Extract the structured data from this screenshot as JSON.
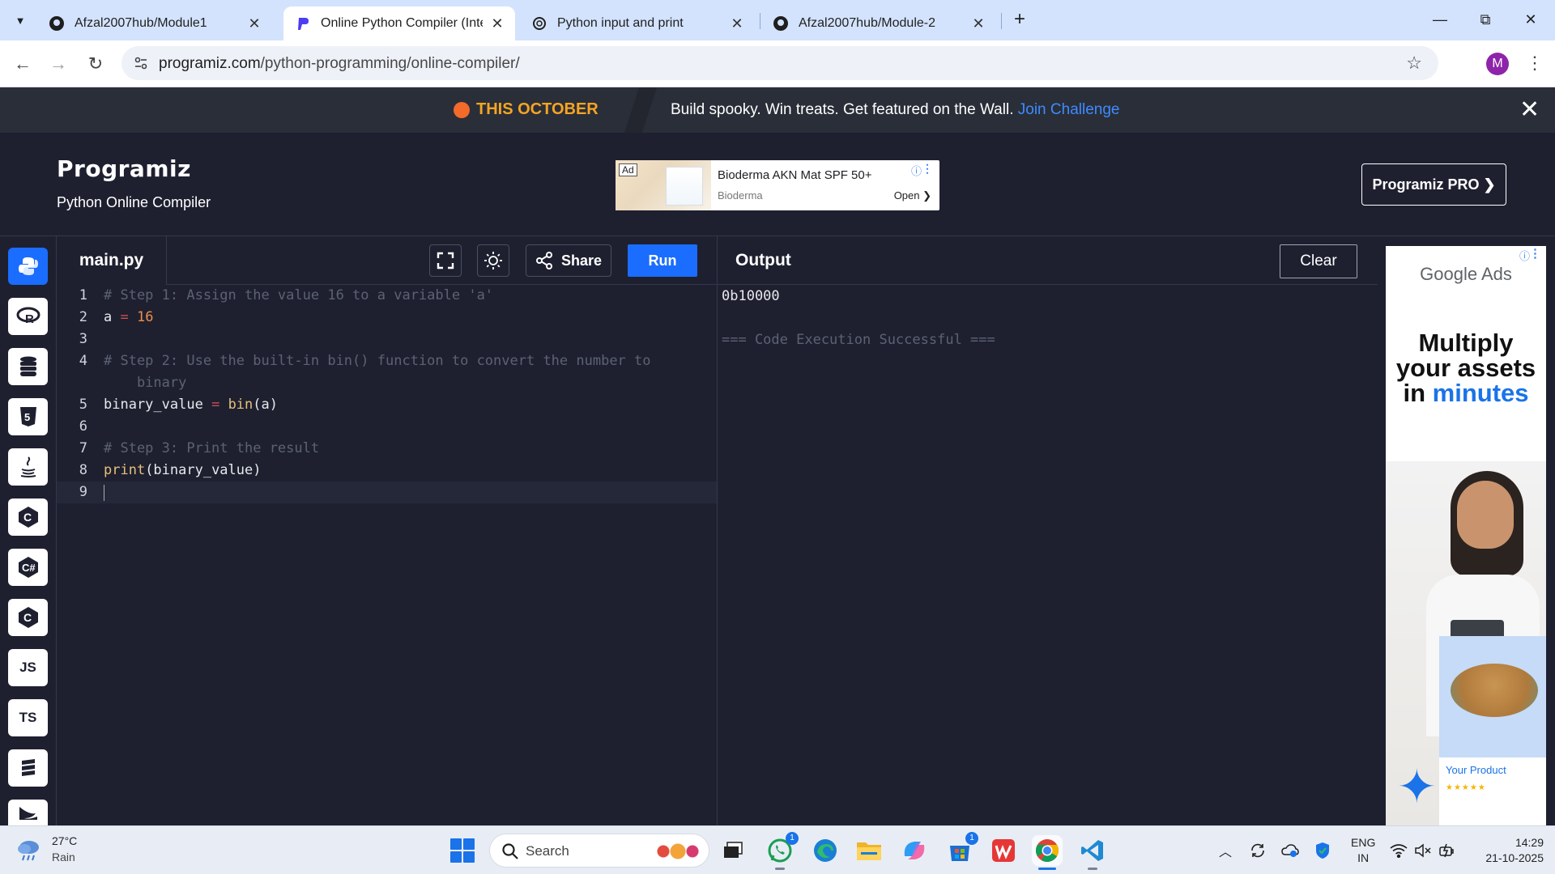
{
  "browser": {
    "tabs": [
      {
        "title": "Afzal2007hub/Module1",
        "icon": "github-icon",
        "active": false
      },
      {
        "title": "Online Python Compiler (Interpreter)",
        "icon": "programiz-icon",
        "active": true
      },
      {
        "title": "Python input and print",
        "icon": "openai-icon",
        "active": false
      },
      {
        "title": "Afzal2007hub/Module-2",
        "icon": "github-icon",
        "active": false
      }
    ],
    "url_domain": "programiz.com",
    "url_path": "/python-programming/online-compiler/",
    "profile_initial": "M"
  },
  "promo": {
    "label": "THIS OCTOBER",
    "text": "Build spooky. Win treats. Get featured on the Wall.",
    "link": "Join Challenge"
  },
  "header": {
    "logo": "Programiz",
    "subtitle": "Python Online Compiler",
    "pro_button": "Programiz PRO ❯",
    "ad": {
      "badge": "Ad",
      "title": "Bioderma AKN Mat SPF 50+",
      "brand": "Bioderma",
      "cta": "Open ❯"
    }
  },
  "sidebar": {
    "languages": [
      {
        "name": "python",
        "label": "",
        "active": true
      },
      {
        "name": "r",
        "label": "",
        "active": false
      },
      {
        "name": "sql",
        "label": "",
        "active": false
      },
      {
        "name": "html",
        "label": "",
        "active": false
      },
      {
        "name": "java",
        "label": "",
        "active": false
      },
      {
        "name": "c",
        "label": "",
        "active": false
      },
      {
        "name": "csharp",
        "label": "",
        "active": false
      },
      {
        "name": "cpp",
        "label": "",
        "active": false
      },
      {
        "name": "javascript",
        "label": "JS",
        "active": false
      },
      {
        "name": "typescript",
        "label": "TS",
        "active": false
      },
      {
        "name": "go",
        "label": "",
        "active": false
      },
      {
        "name": "swift",
        "label": "",
        "active": false
      }
    ]
  },
  "editor": {
    "filename": "main.py",
    "share_label": "Share",
    "run_label": "Run",
    "lines": [
      {
        "n": "1",
        "text": "# Step 1: Assign the value 16 to a variable 'a'"
      },
      {
        "n": "2",
        "text": "a = 16"
      },
      {
        "n": "3",
        "text": ""
      },
      {
        "n": "4",
        "text": "# Step 2: Use the built-in bin() function to convert the number to"
      },
      {
        "n": "",
        "text": "    binary"
      },
      {
        "n": "5",
        "text": "binary_value = bin(a)"
      },
      {
        "n": "6",
        "text": ""
      },
      {
        "n": "7",
        "text": "# Step 3: Print the result"
      },
      {
        "n": "8",
        "text": "print(binary_value)"
      },
      {
        "n": "9",
        "text": ""
      }
    ]
  },
  "output": {
    "title": "Output",
    "clear_label": "Clear",
    "result": "0b10000",
    "status": "=== Code Execution Successful ==="
  },
  "right_ad": {
    "brand": "Google Ads",
    "headline_1": "Multiply",
    "headline_2": "your assets",
    "headline_3": "in",
    "headline_highlight": "minutes",
    "product_label": "Your Product",
    "rating_stars": "★★★★★"
  },
  "taskbar": {
    "weather_temp": "27°C",
    "weather_desc": "Rain",
    "search_placeholder": "Search",
    "whatsapp_badge": "1",
    "store_badge": "1",
    "lang_1": "ENG",
    "lang_2": "IN",
    "time": "14:29",
    "date": "21-10-2025"
  },
  "colors": {
    "accent": "#1a6dff",
    "page_bg": "#1e2030",
    "promo_orange": "#f5a524"
  }
}
